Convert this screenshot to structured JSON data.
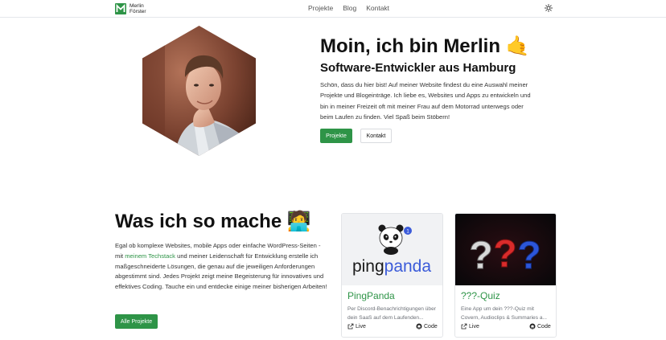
{
  "brand": {
    "first_name": "Merlin",
    "last_name": "Förster",
    "color": "#2e9447"
  },
  "nav": {
    "items": [
      "Projekte",
      "Blog",
      "Kontakt"
    ]
  },
  "hero": {
    "title": "Moin, ich bin Merlin 🤙",
    "subtitle": "Software-Entwickler aus Hamburg",
    "text": "Schön, dass du hier bist! Auf meiner Website findest du eine Auswahl meiner Projekte und Blogeinträge. Ich liebe es, Websites und Apps zu entwickeln und bin in meiner Freizeit oft mit meiner Frau auf dem Motorrad unterwegs oder beim Laufen zu finden. Viel Spaß beim Stöbern!",
    "btn_projects": "Projekte",
    "btn_contact": "Kontakt"
  },
  "work": {
    "title": "Was ich so mache 🧑‍💻",
    "text_before": "Egal ob komplexe Websites, mobile Apps oder einfache WordPress-Seiten - mit ",
    "text_link": "meinem Techstack",
    "text_after": " und meiner Leidenschaft für Entwicklung erstelle ich maßgeschneiderte Lösungen, die genau auf die jeweiligen Anforderungen abgestimmt sind. Jedes Projekt zeigt meine Begeisterung für innovatives und effektives Coding. Tauche ein und entdecke einige meiner bisherigen Arbeiten!",
    "btn_all": "Alle Projekte"
  },
  "cards": [
    {
      "title": "PingPanda",
      "logo_text": "pingpanda",
      "badge": "1",
      "description": "Per Discord-Benachrichtigungen über dein SaaS auf dem Laufenden...",
      "live_label": "Live",
      "code_label": "Code"
    },
    {
      "title": "???-Quiz",
      "description": "Eine App um dein ???-Quiz mit Covern, Audioclips & Summaries a...",
      "live_label": "Live",
      "code_label": "Code"
    }
  ],
  "colors": {
    "accent": "#2e9447",
    "text": "#111111",
    "muted": "#6b6f76"
  }
}
